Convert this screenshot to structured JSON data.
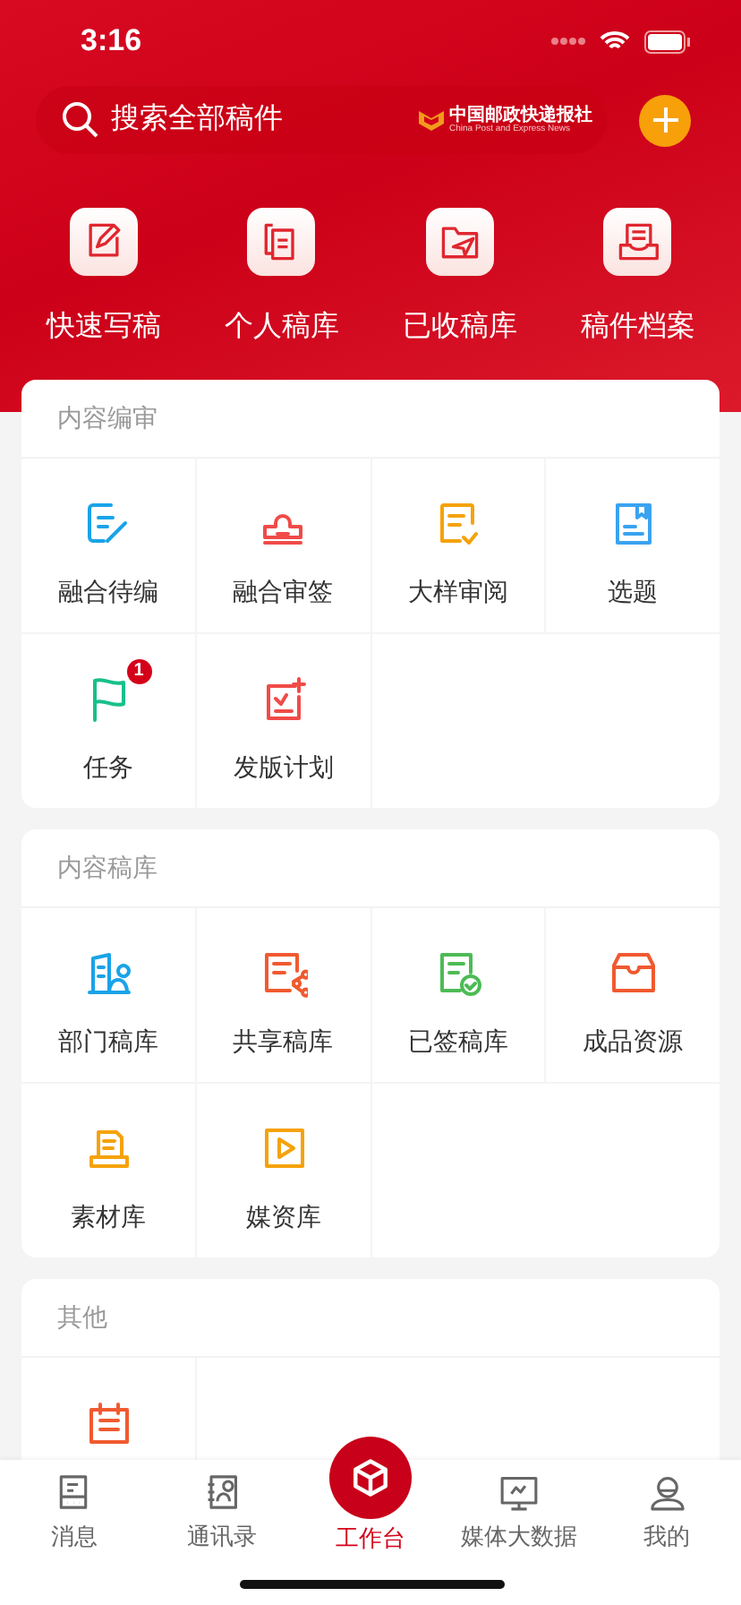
{
  "status_bar": {
    "time": "3:16"
  },
  "search": {
    "placeholder": "搜索全部稿件",
    "logo_name": "中国邮政快递报社",
    "logo_subtitle": "China Post and Express News"
  },
  "quick_actions": [
    {
      "label": "快速写稿"
    },
    {
      "label": "个人稿库"
    },
    {
      "label": "已收稿库"
    },
    {
      "label": "稿件档案"
    }
  ],
  "sections": [
    {
      "title": "内容编审",
      "items": [
        {
          "kind": "tile",
          "label": "融合待编"
        },
        {
          "kind": "tile",
          "label": "融合审签"
        },
        {
          "kind": "tile",
          "label": "大样审阅"
        },
        {
          "kind": "tile",
          "label": "选题"
        },
        {
          "kind": "tile",
          "label": "任务",
          "badge": "1"
        },
        {
          "kind": "tile",
          "label": "发版计划"
        }
      ]
    },
    {
      "title": "内容稿库",
      "items": [
        {
          "kind": "tile",
          "label": "部门稿库"
        },
        {
          "kind": "tile",
          "label": "共享稿库"
        },
        {
          "kind": "tile",
          "label": "已签稿库"
        },
        {
          "kind": "tile",
          "label": "成品资源"
        },
        {
          "kind": "tile",
          "label": "素材库"
        },
        {
          "kind": "tile",
          "label": "媒资库"
        }
      ]
    },
    {
      "title": "其他",
      "items": [
        {
          "kind": "icon-only"
        }
      ]
    }
  ],
  "tab_bar": [
    {
      "label": "消息",
      "selected": false
    },
    {
      "label": "通讯录",
      "selected": false
    },
    {
      "label": "工作台",
      "selected": true
    },
    {
      "label": "媒体大数据",
      "selected": false
    },
    {
      "label": "我的",
      "selected": false
    }
  ]
}
